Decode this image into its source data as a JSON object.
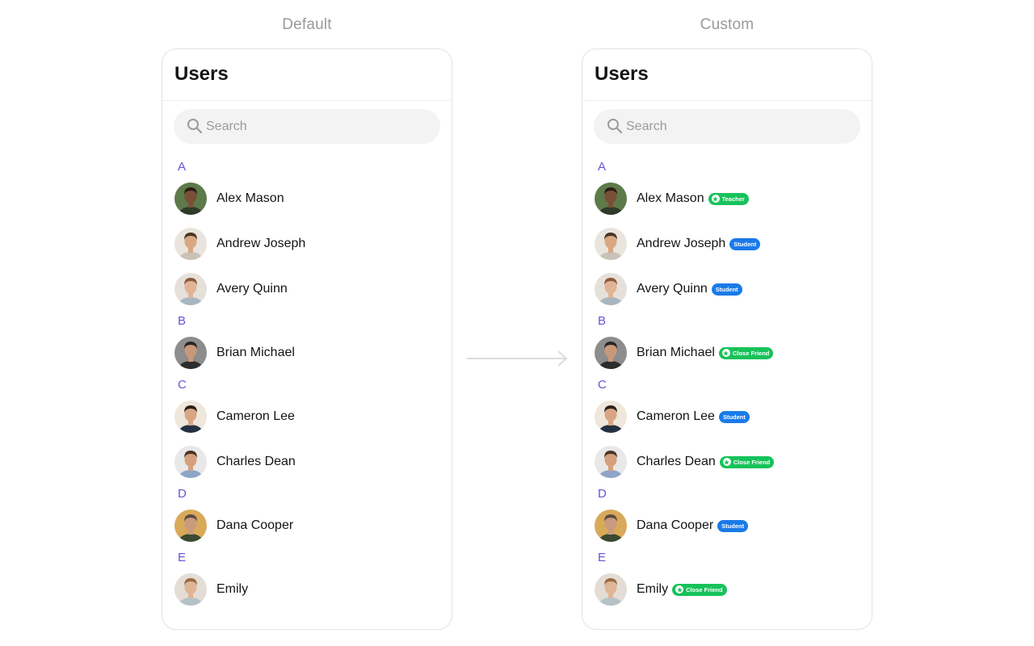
{
  "headers": {
    "default": "Default",
    "custom": "Custom"
  },
  "panel_title": "Users",
  "search": {
    "placeholder": "Search",
    "icon": "search-icon"
  },
  "colors": {
    "section_letter": "#6852d6",
    "student_badge": "#1a7ae8",
    "teacher_badge": "#17c25a",
    "close_friend_badge": "#17c25a"
  },
  "sections": [
    {
      "letter": "A",
      "users": [
        {
          "name": "Alex Mason",
          "badge": "Teacher",
          "badge_color": "green",
          "badge_icon": true
        },
        {
          "name": "Andrew Joseph",
          "badge": "Student",
          "badge_color": "blue",
          "badge_icon": false
        },
        {
          "name": "Avery Quinn",
          "badge": "Student",
          "badge_color": "blue",
          "badge_icon": false
        }
      ]
    },
    {
      "letter": "B",
      "users": [
        {
          "name": "Brian Michael",
          "badge": "Close Friend",
          "badge_color": "green",
          "badge_icon": true
        }
      ]
    },
    {
      "letter": "C",
      "users": [
        {
          "name": "Cameron Lee",
          "badge": "Student",
          "badge_color": "blue",
          "badge_icon": false
        },
        {
          "name": "Charles Dean",
          "badge": "Close Friend",
          "badge_color": "green",
          "badge_icon": true
        }
      ]
    },
    {
      "letter": "D",
      "users": [
        {
          "name": "Dana Cooper",
          "badge": "Student",
          "badge_color": "blue",
          "badge_icon": false
        }
      ]
    },
    {
      "letter": "E",
      "users": [
        {
          "name": "Emily",
          "badge": "Close Friend",
          "badge_color": "green",
          "badge_icon": true
        }
      ]
    }
  ]
}
